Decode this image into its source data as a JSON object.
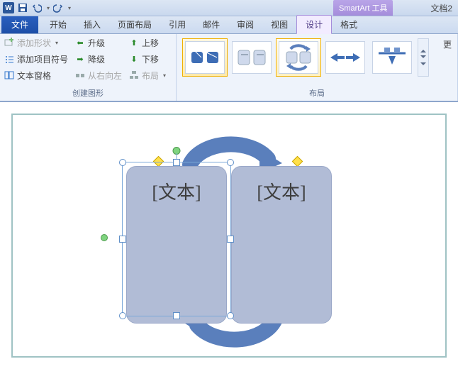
{
  "titlebar": {
    "smartart_tool": "SmartArt 工具",
    "doc_title": "文档2"
  },
  "tabs": {
    "file": "文件",
    "home": "开始",
    "insert": "插入",
    "layout": "页面布局",
    "references": "引用",
    "mailings": "邮件",
    "review": "审阅",
    "view": "视图",
    "design": "设计",
    "format": "格式"
  },
  "ribbon": {
    "create": {
      "add_shape": "添加形状",
      "add_bullet": "添加项目符号",
      "text_pane": "文本窗格",
      "promote": "升级",
      "demote": "降级",
      "rtl": "从右向左",
      "move_up": "上移",
      "move_down": "下移",
      "layout_btn": "布局",
      "group_label": "创建图形"
    },
    "layouts": {
      "group_label": "布局",
      "more": "更"
    }
  },
  "canvas": {
    "textA": "[文本]",
    "textB": "[文本]"
  }
}
